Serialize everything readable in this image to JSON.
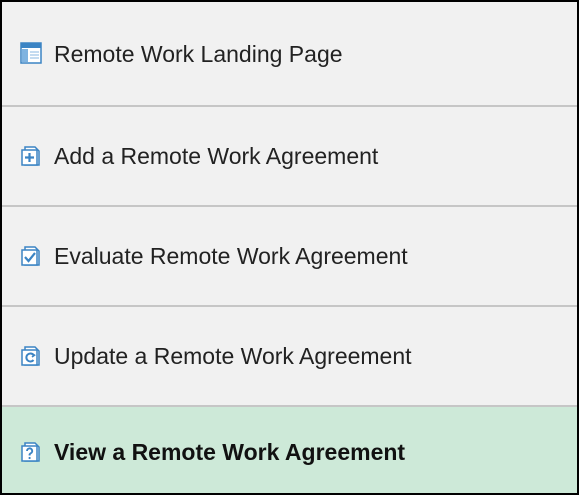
{
  "menu": {
    "items": [
      {
        "label": "Remote Work Landing Page",
        "icon": "landing-page-icon",
        "active": false
      },
      {
        "label": "Add a Remote Work Agreement",
        "icon": "add-document-icon",
        "active": false
      },
      {
        "label": "Evaluate Remote Work Agreement",
        "icon": "evaluate-document-icon",
        "active": false
      },
      {
        "label": "Update a Remote Work Agreement",
        "icon": "update-document-icon",
        "active": false
      },
      {
        "label": "View a Remote Work Agreement",
        "icon": "view-document-icon",
        "active": true
      }
    ]
  },
  "colors": {
    "icon_blue": "#3b84c4",
    "active_background": "#cde9d8",
    "background": "#f1f1f1"
  }
}
